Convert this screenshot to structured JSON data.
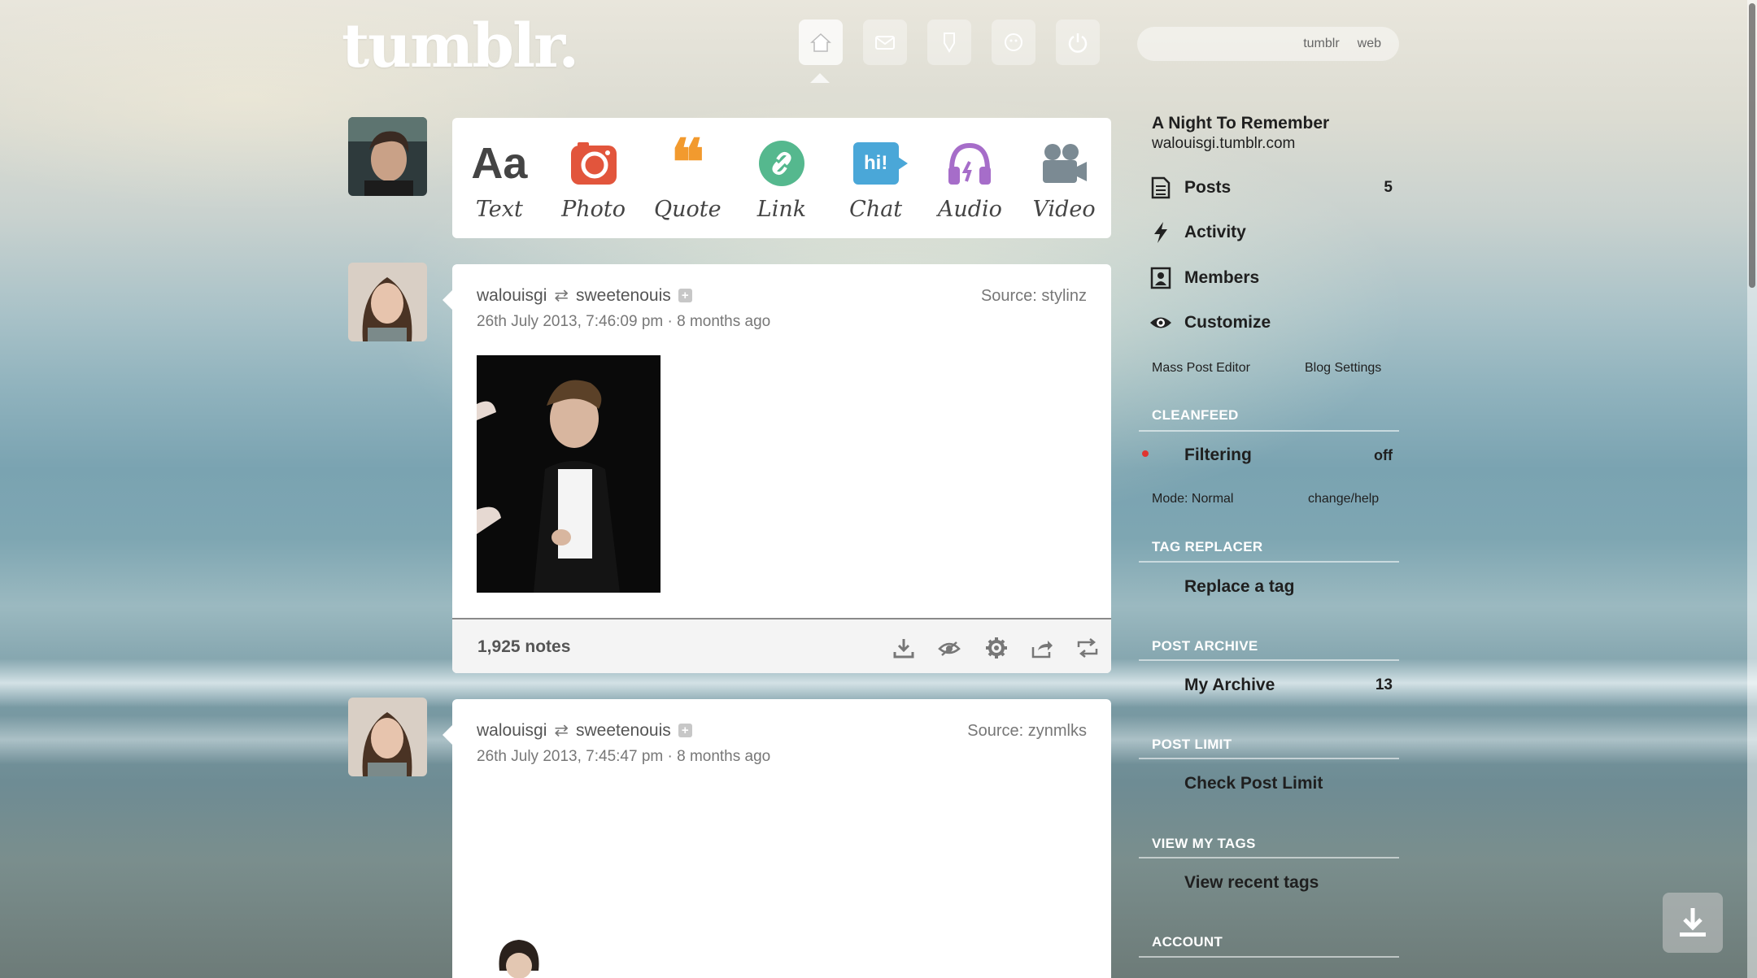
{
  "header": {
    "logo": "tumblr.",
    "nav_icons": [
      "home-icon",
      "mail-icon",
      "activity-icon",
      "account-icon",
      "power-icon"
    ],
    "search": {
      "placeholder": "",
      "scopes": [
        "tumblr",
        "web"
      ]
    }
  },
  "post_types": [
    {
      "label": "Text",
      "icon": "text-icon",
      "glyph": "Aa",
      "color": "#444444"
    },
    {
      "label": "Photo",
      "icon": "camera-icon",
      "color": "#e2553c"
    },
    {
      "label": "Quote",
      "icon": "quote-icon",
      "glyph": "❝",
      "color": "#f29a2e"
    },
    {
      "label": "Link",
      "icon": "link-icon",
      "color": "#55b88e"
    },
    {
      "label": "Chat",
      "icon": "chat-icon",
      "glyph": "hi!",
      "color": "#4aa7d8"
    },
    {
      "label": "Audio",
      "icon": "headphones-icon",
      "color": "#a66dc9"
    },
    {
      "label": "Video",
      "icon": "video-camera-icon",
      "color": "#7b8a93"
    }
  ],
  "posts": [
    {
      "user": "walouisgi",
      "reblogged_from": "sweetenouis",
      "date": "26th July 2013, 7:46:09 pm · 8 months ago",
      "source": "Source: stylinz",
      "notes": "1,925 notes"
    },
    {
      "user": "walouisgi",
      "reblogged_from": "sweetenouis",
      "date": "26th July 2013, 7:45:47 pm · 8 months ago",
      "source": "Source: zynmlks"
    }
  ],
  "sidebar": {
    "blog_title": "A Night To Remember",
    "blog_url": "walouisgi.tumblr.com",
    "items": [
      {
        "label": "Posts",
        "value": "5",
        "icon": "document-icon"
      },
      {
        "label": "Activity",
        "value": "",
        "icon": "lightning-icon"
      },
      {
        "label": "Members",
        "value": "",
        "icon": "members-icon"
      },
      {
        "label": "Customize",
        "value": "",
        "icon": "eye-icon"
      }
    ],
    "mass_post_editor": "Mass Post Editor",
    "blog_settings": "Blog Settings",
    "cleanfeed_head": "CLEANFEED",
    "filtering_label": "Filtering",
    "filtering_value": "off",
    "mode": "Mode: Normal",
    "change_help": "change/help",
    "tag_replacer_head": "TAG REPLACER",
    "replace_tag": "Replace a tag",
    "post_archive_head": "POST ARCHIVE",
    "my_archive": "My Archive",
    "my_archive_count": "13",
    "post_limit_head": "POST LIMIT",
    "check_post_limit": "Check Post Limit",
    "view_tags_head": "VIEW MY TAGS",
    "view_recent_tags": "View recent tags",
    "account_head": "ACCOUNT"
  }
}
